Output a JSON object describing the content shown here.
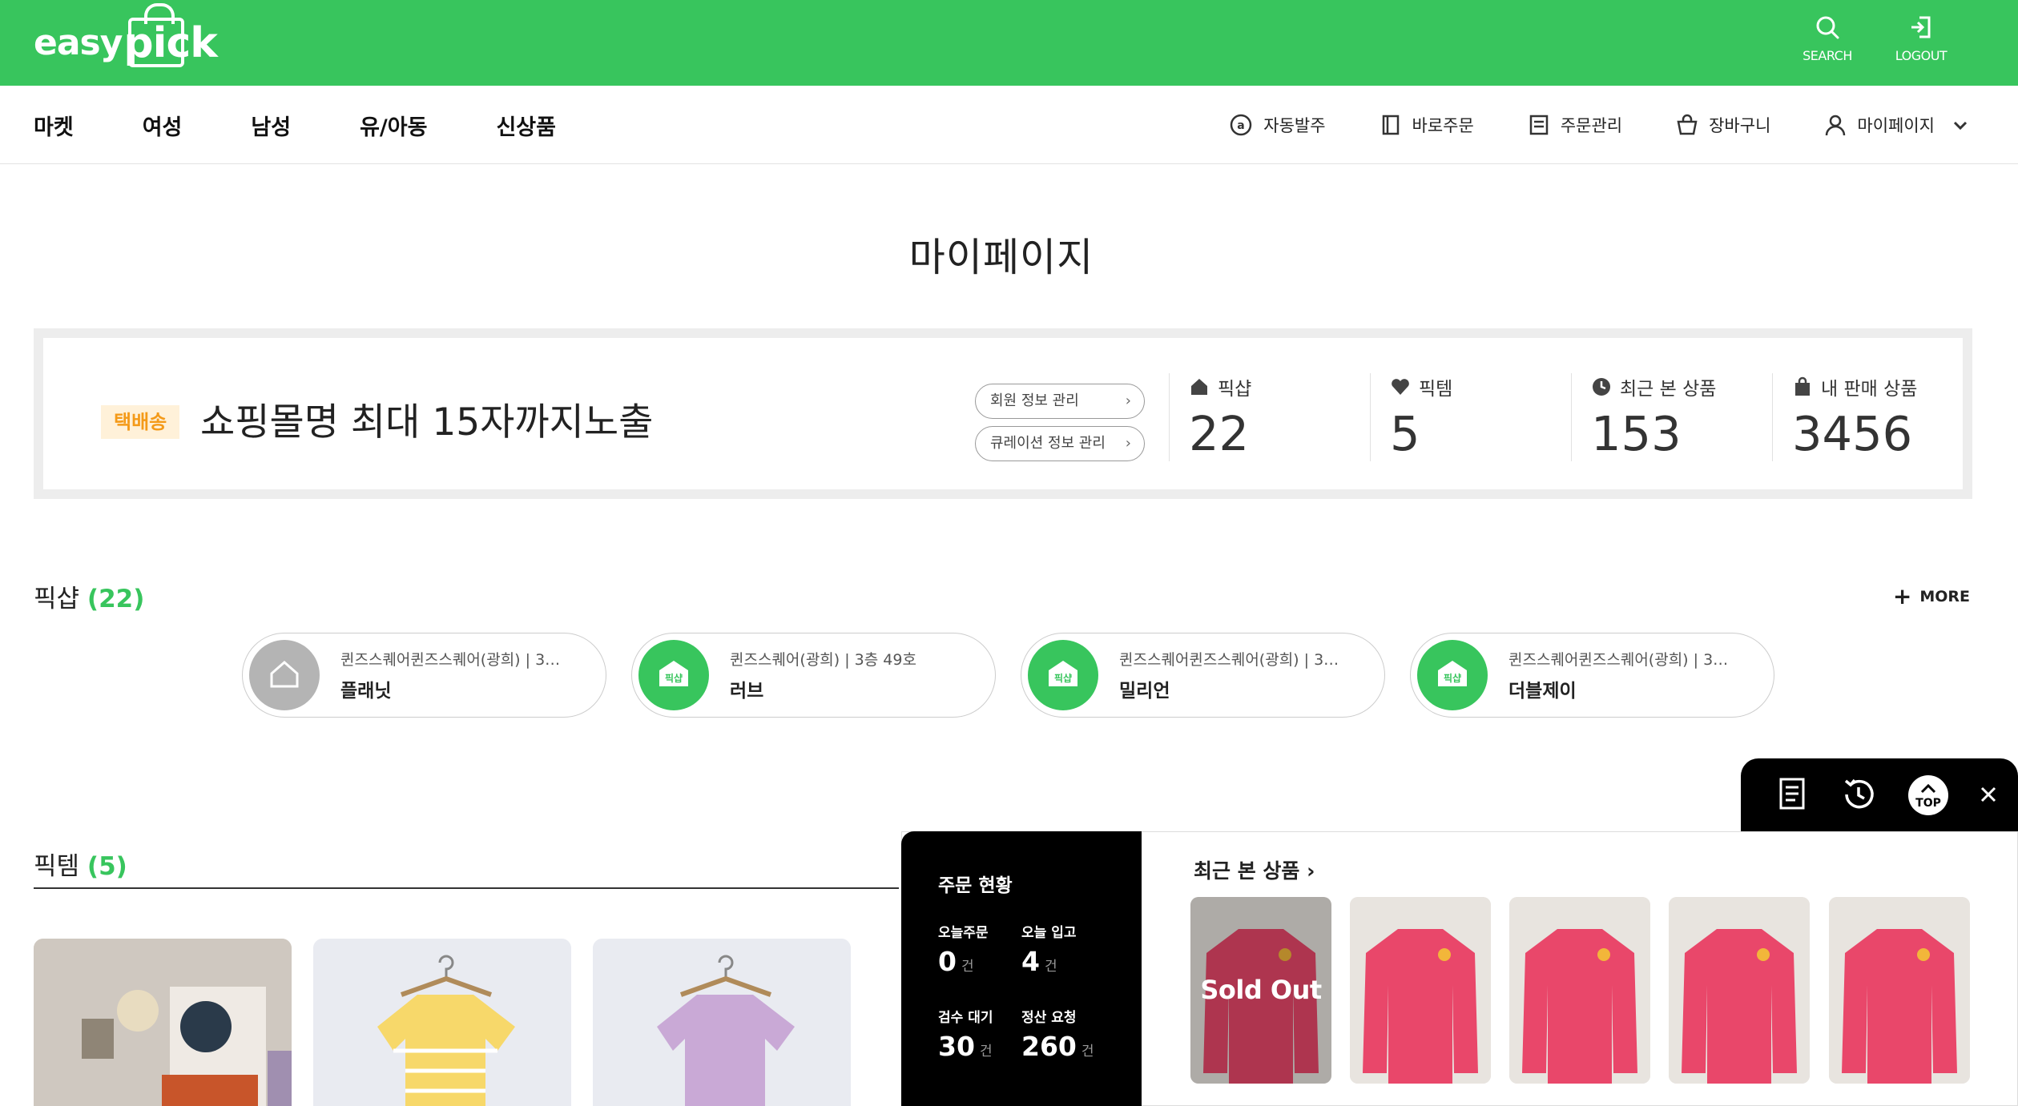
{
  "header": {
    "logo": {
      "part1": "easy",
      "part2": "pick"
    },
    "search_label": "SEARCH",
    "logout_label": "LOGOUT",
    "brand_color": "#38c55d"
  },
  "nav": {
    "main": [
      "마켓",
      "여성",
      "남성",
      "유/아동",
      "신상품"
    ],
    "util": [
      {
        "label": "자동발주",
        "icon": "at-circle-icon"
      },
      {
        "label": "바로주문",
        "icon": "book-icon"
      },
      {
        "label": "주문관리",
        "icon": "receipt-icon"
      },
      {
        "label": "장바구니",
        "icon": "basket-icon"
      },
      {
        "label": "마이페이지",
        "icon": "user-icon"
      }
    ]
  },
  "page_title": "마이페이지",
  "profile": {
    "badge": "택배송",
    "shop_name": "쇼핑몰명 최대 15자까지노출",
    "buttons": [
      "회원 정보 관리",
      "큐레이션 정보 관리"
    ],
    "stats": [
      {
        "label": "픽샵",
        "value": "22",
        "icon": "shop-icon"
      },
      {
        "label": "픽템",
        "value": "5",
        "icon": "heart-icon"
      },
      {
        "label": "최근 본 상품",
        "value": "153",
        "icon": "clock-icon"
      },
      {
        "label": "내 판매 상품",
        "value": "3456",
        "icon": "shopping-bag-icon"
      }
    ]
  },
  "pickshop": {
    "title": "픽샵",
    "count": "(22)",
    "more": "MORE",
    "shops": [
      {
        "location": "퀸즈스퀘어퀸즈스퀘어(광희) | 3…",
        "name": "플래닛",
        "avatar": "gray"
      },
      {
        "location": "퀸즈스퀘어(광희) | 3층 49호",
        "name": "러브",
        "avatar": "green"
      },
      {
        "location": "퀸즈스퀘어퀸즈스퀘어(광희) | 3…",
        "name": "밀리언",
        "avatar": "green"
      },
      {
        "location": "퀸즈스퀘어퀸즈스퀘어(광희) | 3…",
        "name": "더블제이",
        "avatar": "green"
      }
    ],
    "avatar_label": "픽샵"
  },
  "pickitem": {
    "title": "픽템",
    "count": "(5)"
  },
  "floating": {
    "top_label": "TOP",
    "order_status": {
      "title": "주문 현황",
      "items": [
        {
          "label": "오늘주문",
          "value": "0",
          "unit": "건"
        },
        {
          "label": "오늘 입고",
          "value": "4",
          "unit": "건"
        },
        {
          "label": "검수 대기",
          "value": "30",
          "unit": "건"
        },
        {
          "label": "정산 요청",
          "value": "260",
          "unit": "건"
        }
      ]
    },
    "recent": {
      "title": "최근 본 상품",
      "sold_out": "Sold Out"
    }
  }
}
